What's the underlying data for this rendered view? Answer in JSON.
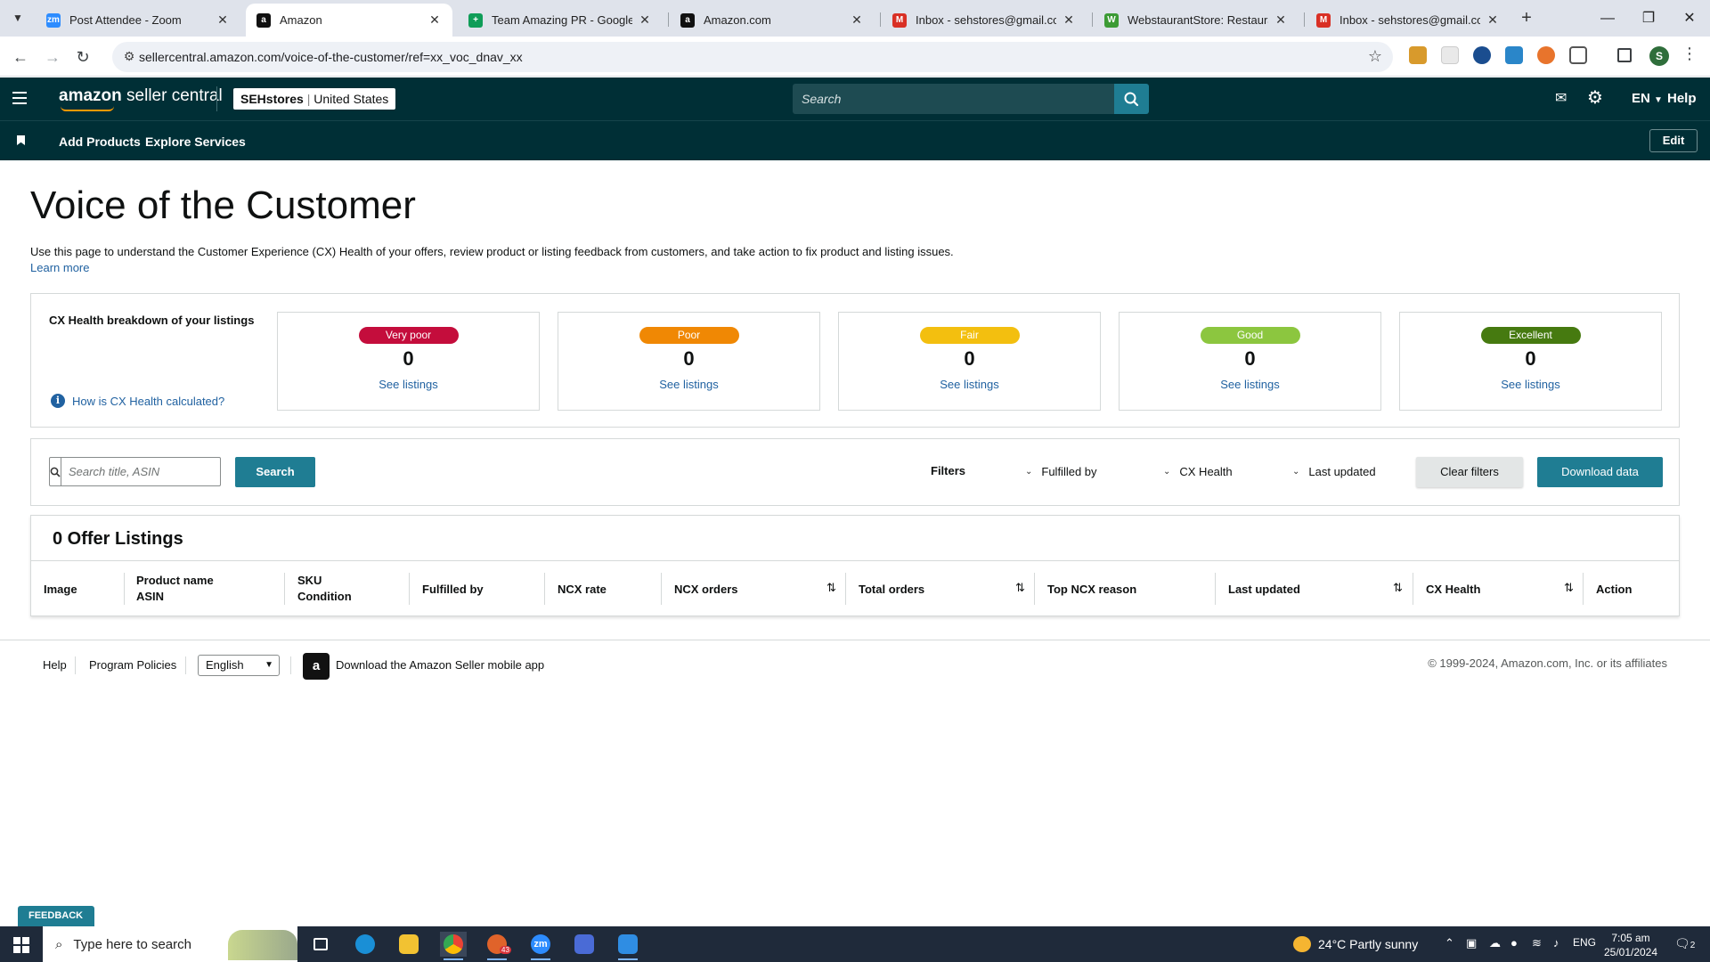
{
  "browser": {
    "tabs": [
      {
        "title": "Post Attendee - Zoom",
        "favicon": "zoom-icon",
        "fav_color": "#2d8cff",
        "fav_text": "zm",
        "active": false
      },
      {
        "title": "Amazon",
        "favicon": "amazon-icon",
        "fav_color": "#111111",
        "fav_text": "a",
        "active": true
      },
      {
        "title": "Team Amazing PR - Google Sh",
        "favicon": "google-sheets-icon",
        "fav_color": "#0f9d58",
        "fav_text": "+",
        "active": false
      },
      {
        "title": "Amazon.com",
        "favicon": "amazon-icon",
        "fav_color": "#111111",
        "fav_text": "a",
        "active": false
      },
      {
        "title": "Inbox - sehstores@gmail.com",
        "favicon": "gmail-icon",
        "fav_color": "#d93025",
        "fav_text": "M",
        "active": false
      },
      {
        "title": "WebstaurantStore: Restaurant S",
        "favicon": "webstaurant-icon",
        "fav_color": "#3c9b35",
        "fav_text": "W",
        "active": false
      },
      {
        "title": "Inbox - sehstores@gmail.com",
        "favicon": "gmail-icon",
        "fav_color": "#d93025",
        "fav_text": "M",
        "active": false
      }
    ],
    "url": "sellercentral.amazon.com/voice-of-the-customer/ref=xx_voc_dnav_xx",
    "profile_initial": "S"
  },
  "header": {
    "logo_bold": "amazon",
    "logo_rest": " seller central",
    "store_name": "SEHstores",
    "marketplace": "United States",
    "search_placeholder": "Search",
    "language": "EN",
    "help": "Help"
  },
  "subnav": {
    "items": [
      "Add Products",
      "Explore Services"
    ],
    "edit": "Edit"
  },
  "page": {
    "title": "Voice of the Customer",
    "description": "Use this page to understand the Customer Experience (CX) Health of your offers, review product or listing feedback from customers, and take action to fix product and listing issues.",
    "learn_more": "Learn more"
  },
  "cx_health": {
    "label": "CX Health breakdown of your listings",
    "how_link": "How is CX Health calculated?",
    "cards": [
      {
        "label": "Very poor",
        "count": "0",
        "link": "See listings",
        "color": "#c40d3c"
      },
      {
        "label": "Poor",
        "count": "0",
        "link": "See listings",
        "color": "#f08804"
      },
      {
        "label": "Fair",
        "count": "0",
        "link": "See listings",
        "color": "#f3bf0f"
      },
      {
        "label": "Good",
        "count": "0",
        "link": "See listings",
        "color": "#8cc63f"
      },
      {
        "label": "Excellent",
        "count": "0",
        "link": "See listings",
        "color": "#467a10"
      }
    ]
  },
  "filters": {
    "search_placeholder": "Search title, ASIN",
    "search_button": "Search",
    "filters_label": "Filters",
    "dropdowns": [
      "Fulfilled by",
      "CX Health",
      "Last updated"
    ],
    "clear": "Clear filters",
    "download": "Download data"
  },
  "listings": {
    "title": "0 Offer Listings",
    "columns": [
      {
        "line1": "Image",
        "line2": ""
      },
      {
        "line1": "Product name",
        "line2": "ASIN"
      },
      {
        "line1": "SKU",
        "line2": "Condition"
      },
      {
        "line1": "Fulfilled by",
        "line2": ""
      },
      {
        "line1": "NCX rate",
        "line2": ""
      },
      {
        "line1": "NCX orders",
        "line2": ""
      },
      {
        "line1": "Total orders",
        "line2": ""
      },
      {
        "line1": "Top NCX reason",
        "line2": ""
      },
      {
        "line1": "Last updated",
        "line2": ""
      },
      {
        "line1": "CX Health",
        "line2": ""
      },
      {
        "line1": "Action",
        "line2": ""
      }
    ]
  },
  "footer": {
    "help": "Help",
    "policies": "Program Policies",
    "language": "English",
    "app_text": "Download the Amazon Seller mobile app",
    "copyright": "© 1999-2024, Amazon.com, Inc. or its affiliates"
  },
  "feedback": "FEEDBACK",
  "taskbar": {
    "search_placeholder": "Type here to search",
    "weather": "24°C  Partly sunny",
    "lang": "ENG",
    "time": "7:05 am",
    "date": "25/01/2024",
    "notifications": "2",
    "telegram_badge": "43"
  }
}
